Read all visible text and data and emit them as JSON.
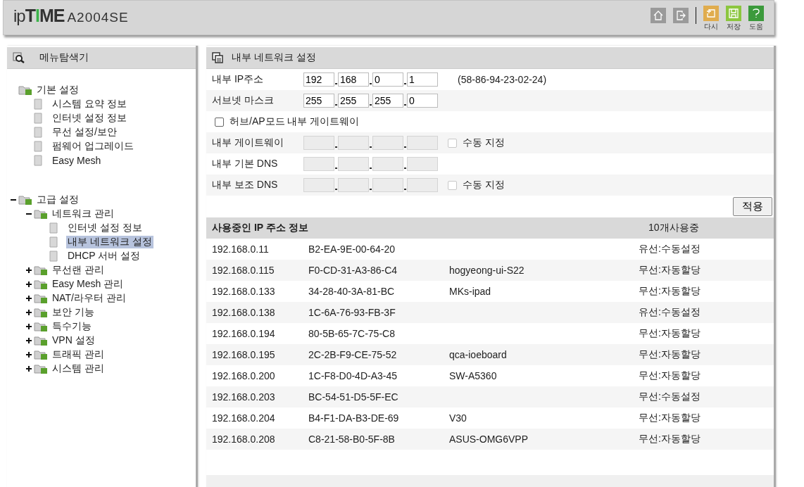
{
  "header": {
    "logo": {
      "prefix": "ip",
      "brand": "TIME",
      "model": "A2004SE"
    },
    "tools": [
      {
        "kind": "home"
      },
      {
        "kind": "logout"
      }
    ],
    "actions": [
      {
        "kind": "reset",
        "label": "다시",
        "color": "#e0ac4e"
      },
      {
        "kind": "save",
        "label": "저장",
        "color": "#8cc63f"
      },
      {
        "kind": "help",
        "label": "도움",
        "color": "#3c9a3c"
      }
    ]
  },
  "sidebar": {
    "title": "메뉴탐색기",
    "tree": [
      {
        "label": "기본 설정",
        "selected": false,
        "children": [
          {
            "label": "시스템 요약 정보",
            "selected": false
          },
          {
            "label": "인터넷 설정 정보",
            "selected": false
          },
          {
            "label": "무선 설정/보안",
            "selected": false
          },
          {
            "label": "펌웨어 업그레이드",
            "selected": false
          },
          {
            "label": "Easy Mesh",
            "selected": false
          }
        ]
      },
      {
        "label": "고급 설정",
        "selected": false,
        "expanded": true,
        "children": [
          {
            "label": "네트워크 관리",
            "selected": false,
            "expanded": true,
            "children": [
              {
                "label": "인터넷 설정 정보",
                "selected": false
              },
              {
                "label": "내부 네트워크 설정",
                "selected": true
              },
              {
                "label": "DHCP 서버 설정",
                "selected": false
              }
            ]
          },
          {
            "label": "무선랜 관리",
            "selected": false,
            "expanded": false
          },
          {
            "label": "Easy Mesh 관리",
            "selected": false,
            "expanded": false
          },
          {
            "label": "NAT/라우터 관리",
            "selected": false,
            "expanded": false
          },
          {
            "label": "보안 기능",
            "selected": false,
            "expanded": false
          },
          {
            "label": "특수기능",
            "selected": false,
            "expanded": false
          },
          {
            "label": "VPN 설정",
            "selected": false,
            "expanded": false
          },
          {
            "label": "트래픽 관리",
            "selected": false,
            "expanded": false
          },
          {
            "label": "시스템 관리",
            "selected": false,
            "expanded": false
          }
        ]
      }
    ]
  },
  "panel": {
    "title": "내부 네트워크 설정",
    "form": [
      {
        "kind": "ip",
        "label": "내부 IP주소",
        "disabled": false,
        "octets": [
          "192",
          "168",
          "0",
          "1"
        ],
        "note": "(58-86-94-23-02-24)"
      },
      {
        "kind": "ip",
        "label": "서브넷 마스크",
        "disabled": false,
        "octets": [
          "255",
          "255",
          "255",
          "0"
        ]
      },
      {
        "kind": "check",
        "label": "허브/AP모드 내부 게이트웨이",
        "checked": false
      },
      {
        "kind": "ip",
        "label": "내부 게이트웨이",
        "disabled": true,
        "manual": {
          "label": "수동 지정",
          "checked": false
        }
      },
      {
        "kind": "ip",
        "label": "내부 기본 DNS",
        "disabled": true
      },
      {
        "kind": "ip",
        "label": "내부 보조 DNS",
        "disabled": true,
        "manual": {
          "label": "수동 지정",
          "checked": false
        }
      }
    ],
    "apply": "적용",
    "table": {
      "title": "사용중인 IP 주소 정보",
      "count": "10개사용중",
      "rows": [
        {
          "ip": "192.168.0.11",
          "mac": "B2-EA-9E-00-64-20",
          "type": "유선:수동설정"
        },
        {
          "ip": "192.168.0.115",
          "mac": "F0-CD-31-A3-86-C4",
          "name": "hogyeong-ui-S22",
          "type": "무선:자동할당"
        },
        {
          "ip": "192.168.0.133",
          "mac": "34-28-40-3A-81-BC",
          "name": "MKs-ipad",
          "type": "무선:자동할당"
        },
        {
          "ip": "192.168.0.138",
          "mac": "1C-6A-76-93-FB-3F",
          "type": "유선:수동설정"
        },
        {
          "ip": "192.168.0.194",
          "mac": "80-5B-65-7C-75-C8",
          "type": "무선:자동할당"
        },
        {
          "ip": "192.168.0.195",
          "mac": "2C-2B-F9-CE-75-52",
          "name": "qca-ioeboard",
          "type": "무선:자동할당"
        },
        {
          "ip": "192.168.0.200",
          "mac": "1C-F8-D0-4D-A3-45",
          "name": "SW-A5360",
          "type": "무선:자동할당"
        },
        {
          "ip": "192.168.0.203",
          "mac": "BC-54-51-D5-5F-EC",
          "type": "무선:수동설정"
        },
        {
          "ip": "192.168.0.204",
          "mac": "B4-F1-DA-B3-DE-69",
          "name": "V30",
          "type": "무선:자동할당"
        },
        {
          "ip": "192.168.0.208",
          "mac": "C8-21-58-B0-5F-8B",
          "name": "ASUS-OMG6VPP",
          "type": "무선:자동할당"
        }
      ]
    }
  }
}
